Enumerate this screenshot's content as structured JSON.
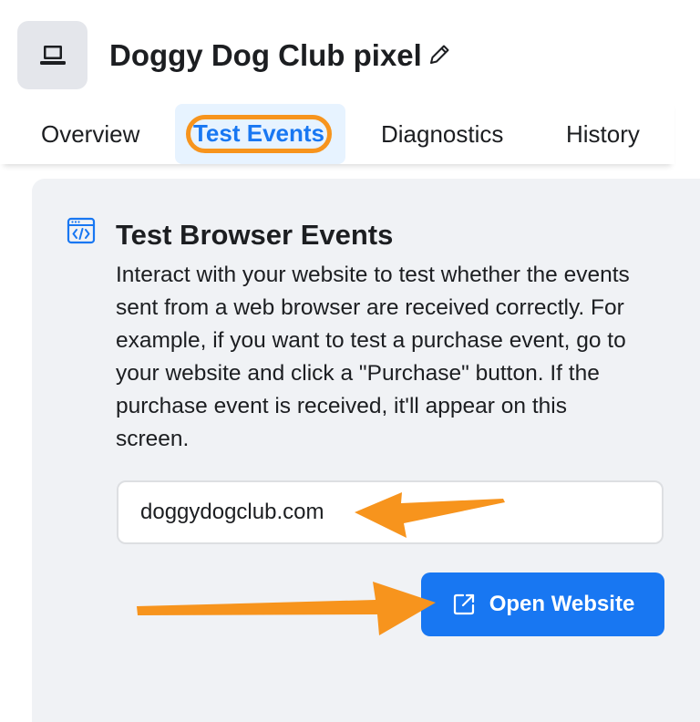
{
  "header": {
    "title": "Doggy Dog Club pixel",
    "icon": "laptop-icon",
    "edit_icon": "pencil-icon"
  },
  "tabs": [
    {
      "label": "Overview",
      "active": false
    },
    {
      "label": "Test Events",
      "active": true
    },
    {
      "label": "Diagnostics",
      "active": false
    },
    {
      "label": "History",
      "active": false
    }
  ],
  "test_browser_events": {
    "icon": "browser-code-icon",
    "title": "Test Browser Events",
    "description": "Interact with your website to test whether the events sent from a web browser are received correctly. For example, if you want to test a purchase event, go to your website and click a \"Purchase\" button. If the purchase event is received, it'll appear on this screen.",
    "url_input": {
      "value": "doggydogclub.com"
    },
    "open_button": {
      "label": "Open Website",
      "icon": "external-link-icon"
    }
  },
  "annotations": {
    "highlight_color": "#f7941d",
    "arrows": [
      "arrow-to-url-input",
      "arrow-to-open-button"
    ]
  },
  "colors": {
    "accent": "#1877f2",
    "card_background": "#f0f2f5",
    "annotation": "#f7941d"
  }
}
